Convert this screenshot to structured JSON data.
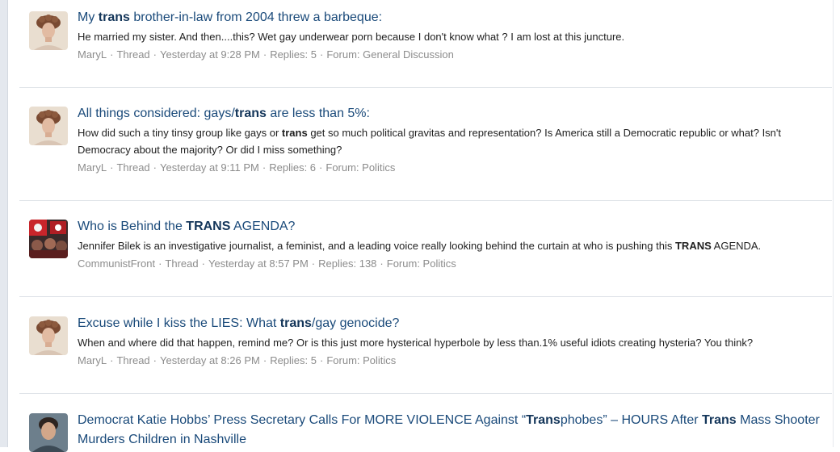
{
  "results": [
    {
      "avatar": "victorian-portrait-avatar",
      "title": [
        "My ",
        {
          "b": "trans"
        },
        " brother-in-law from 2004 threw a barbeque:"
      ],
      "snippet": [
        "He married my sister. And then....this? Wet gay underwear porn because I don't know what ? I am lost at this juncture."
      ],
      "author": "MaryL",
      "type": "Thread",
      "time": "Yesterday at 9:28 PM",
      "replies": "Replies: 5",
      "forum": "Forum: General Discussion"
    },
    {
      "avatar": "victorian-portrait-avatar",
      "title": [
        "All things considered: gays/",
        {
          "b": "trans"
        },
        " are less than 5%:"
      ],
      "snippet": [
        "How did such a tiny tinsy group like gays or ",
        {
          "b": "trans"
        },
        " get so much political gravitas and representation? Is America still a Democratic republic or what? Isn't Democracy about the majority? Or did I miss something?"
      ],
      "author": "MaryL",
      "type": "Thread",
      "time": "Yesterday at 9:11 PM",
      "replies": "Replies: 6",
      "forum": "Forum: Politics"
    },
    {
      "avatar": "crowd-flags-avatar",
      "title": [
        "Who is Behind the ",
        {
          "b": "TRANS"
        },
        " AGENDA?"
      ],
      "snippet": [
        "Jennifer Bilek is an investigative journalist, a feminist, and a leading voice really looking behind the curtain at who is pushing this ",
        {
          "b": "TRANS"
        },
        " AGENDA."
      ],
      "author": "CommunistFront",
      "type": "Thread",
      "time": "Yesterday at 8:57 PM",
      "replies": "Replies: 138",
      "forum": "Forum: Politics"
    },
    {
      "avatar": "victorian-portrait-avatar",
      "title": [
        "Excuse while I kiss the LIES: What ",
        {
          "b": "trans"
        },
        "/gay genocide?"
      ],
      "snippet": [
        "When and where did that happen, remind me? Or is this just more hysterical hyperbole by less than.1% useful idiots creating hysteria? You think?"
      ],
      "author": "MaryL",
      "type": "Thread",
      "time": "Yesterday at 8:26 PM",
      "replies": "Replies: 5",
      "forum": "Forum: Politics"
    },
    {
      "avatar": "man-portrait-avatar",
      "title": [
        "Democrat Katie Hobbs’ Press Secretary Calls For MORE VIOLENCE Against “",
        {
          "b": "Trans"
        },
        "phobes” – HOURS After ",
        {
          "b": "Trans"
        },
        " Mass Shooter Murders Children in Nashville"
      ],
      "snippet": [],
      "author": "",
      "type": "",
      "time": "",
      "replies": "",
      "forum": ""
    }
  ],
  "meta_separator": "·"
}
